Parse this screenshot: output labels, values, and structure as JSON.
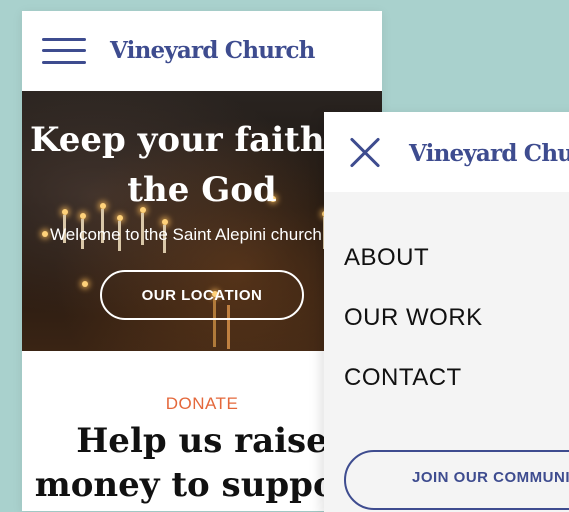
{
  "brand": {
    "name": "Vineyard Church",
    "color": "#3e4c8f"
  },
  "hero": {
    "title_line1": "Keep your faith in",
    "title_line2": "the God",
    "subtitle": "Welcome to the Saint Alepini church",
    "location_button": "OUR LOCATION"
  },
  "donate": {
    "label": "DONATE",
    "label_color": "#e4683b",
    "title_line1": "Help us raise",
    "title_line2": "money to support"
  },
  "menu": {
    "items": [
      {
        "label": "ABOUT"
      },
      {
        "label": "OUR WORK"
      },
      {
        "label": "CONTACT"
      }
    ],
    "cta_button": "JOIN OUR COMMUNITY"
  },
  "icons": {
    "menu": "hamburger-menu-icon",
    "close": "close-icon"
  },
  "colors": {
    "background": "#a9d1cd",
    "menu_panel": "#f4f4f4"
  }
}
